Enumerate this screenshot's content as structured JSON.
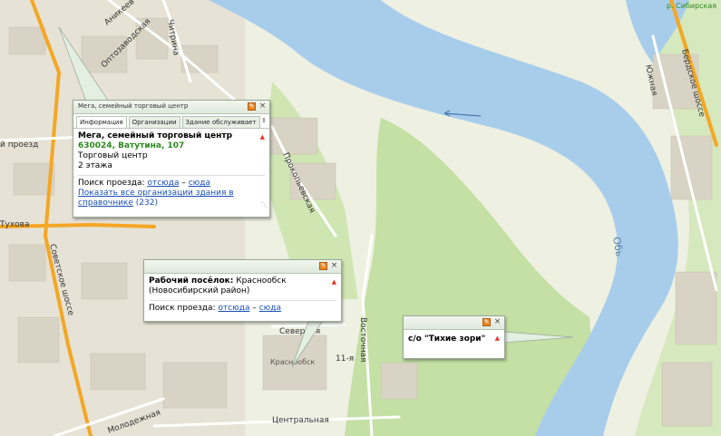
{
  "map": {
    "labels": {
      "top_right": "р. Сибирская",
      "chitrina": "Читрина",
      "anikeyev": "Аникеев",
      "octobr": "Оптозаводская",
      "proezd": "й проезд",
      "tukhova": "Тухова",
      "sovetskoe": "Советское шоссе",
      "prokop": "Прокопьевская",
      "severnaya": "Северная",
      "krasnoobsk": "Краснообск",
      "eleven": "11-я",
      "vostochnaya": "Восточная",
      "molodezhnaya": "Молодежная",
      "centralnaya": "Центральная",
      "berdskoe": "Бердское шоссе",
      "yuzhnaya": "Южная",
      "ob": "Обь"
    },
    "colors": {
      "water": "#a8cdeb",
      "forest": "#c4e0a4",
      "background": "#eef0e2",
      "road_major": "#f5a623",
      "building": "#d8d3c4"
    }
  },
  "popup_mega": {
    "title": "Мега, семейный торговый центр",
    "tabs": [
      "Информация",
      "Организации",
      "Здание обслуживает"
    ],
    "name": "Мега, семейный торговый центр",
    "address": "630024, Ватутина, 107",
    "type": "Торговый центр",
    "floors": "2 этажа",
    "route_label": "Поиск проезда:",
    "route_from": "отсюда",
    "route_dash": " – ",
    "route_to": "сюда",
    "show_all": "Показать все организации здания в справочнике",
    "count": "(232)"
  },
  "popup_krasnoobsk": {
    "type_label": "Рабочий посёлок:",
    "name": "Краснообск",
    "district": "(Новосибирский район)",
    "route_label": "Поиск проезда:",
    "route_from": "отсюда",
    "route_dash": " – ",
    "route_to": "сюда"
  },
  "popup_zori": {
    "name": "с/о \"Тихие зори\""
  }
}
